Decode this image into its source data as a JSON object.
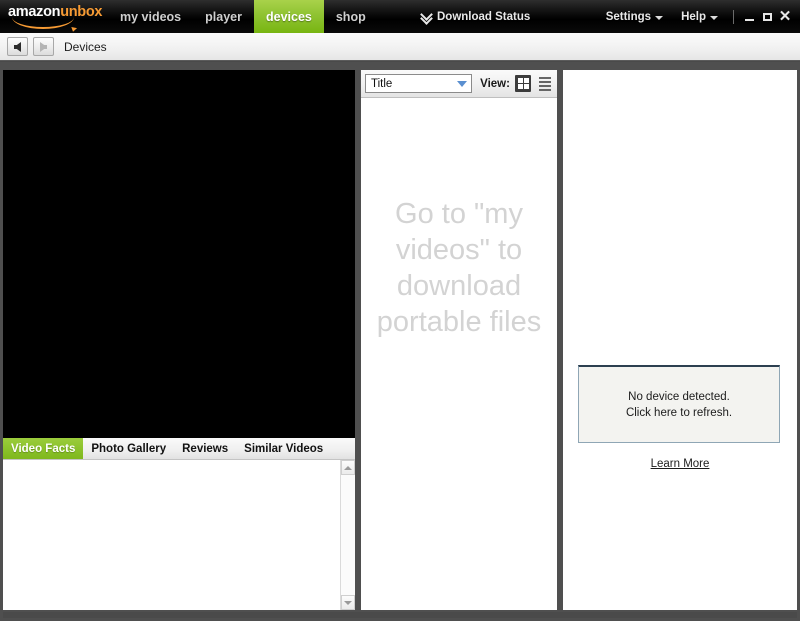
{
  "window": {
    "app_name": "amazon unbox",
    "logo_part_1": "amazon",
    "logo_part_2": "unbox",
    "accent_green": "#8cc22c",
    "accent_orange": "#f79b34",
    "titlebar_bg": "#000000"
  },
  "nav": {
    "tabs": [
      {
        "label": "my videos",
        "active": false
      },
      {
        "label": "player",
        "active": false
      },
      {
        "label": "devices",
        "active": true
      },
      {
        "label": "shop",
        "active": false
      }
    ],
    "download_status": "Download Status",
    "download_status_icon": "chevron-double-down-icon"
  },
  "titlebar_right": {
    "settings": "Settings",
    "help": "Help",
    "minimize_icon": "minimize-icon",
    "maximize_icon": "maximize-icon",
    "close_icon": "close-icon",
    "close_glyph": "✕"
  },
  "breadcrumb": {
    "back_icon": "arrow-left-icon",
    "forward_icon": "arrow-right-icon",
    "label": "Devices"
  },
  "left_panel": {
    "video_stage_state": "empty-black",
    "tabs": [
      {
        "label": "Video Facts",
        "active": true
      },
      {
        "label": "Photo Gallery",
        "active": false
      },
      {
        "label": "Reviews",
        "active": false
      },
      {
        "label": "Similar Videos",
        "active": false
      }
    ],
    "detail_content": "",
    "scrollbar": {
      "up_icon": "scroll-up-icon",
      "down_icon": "scroll-down-icon"
    }
  },
  "middle_panel": {
    "sort_select": {
      "value": "Title",
      "options": [
        "Title"
      ],
      "caret_icon": "chevron-down-icon"
    },
    "view_label": "View:",
    "view_modes": [
      {
        "name": "grid-view",
        "icon": "grid-view-icon",
        "selected": true
      },
      {
        "name": "list-view",
        "icon": "list-view-icon",
        "selected": false
      }
    ],
    "empty_message": "Go to \"my videos\" to download portable files"
  },
  "right_panel": {
    "device_box_message": "No device detected.\nClick here to refresh.",
    "learn_more": "Learn More",
    "box_border_color": "#2c3f50"
  }
}
